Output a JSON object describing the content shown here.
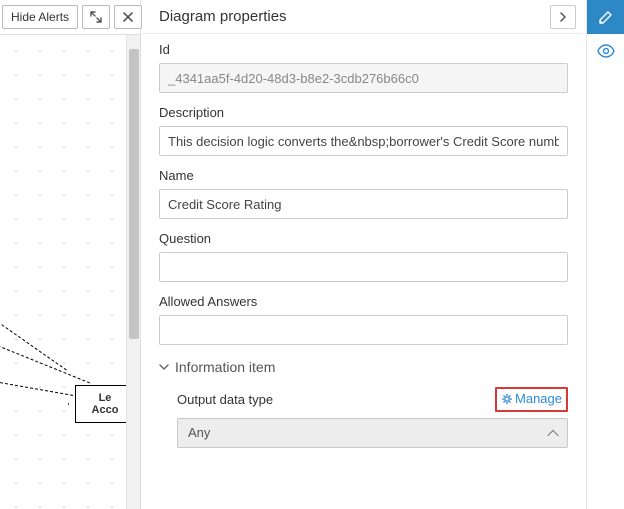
{
  "toolbar": {
    "hide_alerts": "Hide Alerts"
  },
  "canvas": {
    "node_label": "Le\nAcco"
  },
  "panel": {
    "title": "Diagram properties",
    "fields": {
      "id_label": "Id",
      "id_value": "_4341aa5f-4d20-48d3-b8e2-3cdb276b66c0",
      "description_label": "Description",
      "description_value": "This decision logic converts the&nbsp;borrower's Credit Score number t",
      "name_label": "Name",
      "name_value": "Credit Score Rating",
      "question_label": "Question",
      "question_value": "",
      "allowed_answers_label": "Allowed Answers",
      "allowed_answers_value": ""
    },
    "section": {
      "information_item": "Information item",
      "output_data_type_label": "Output data type",
      "manage_label": "Manage",
      "output_data_type_value": "Any"
    }
  }
}
